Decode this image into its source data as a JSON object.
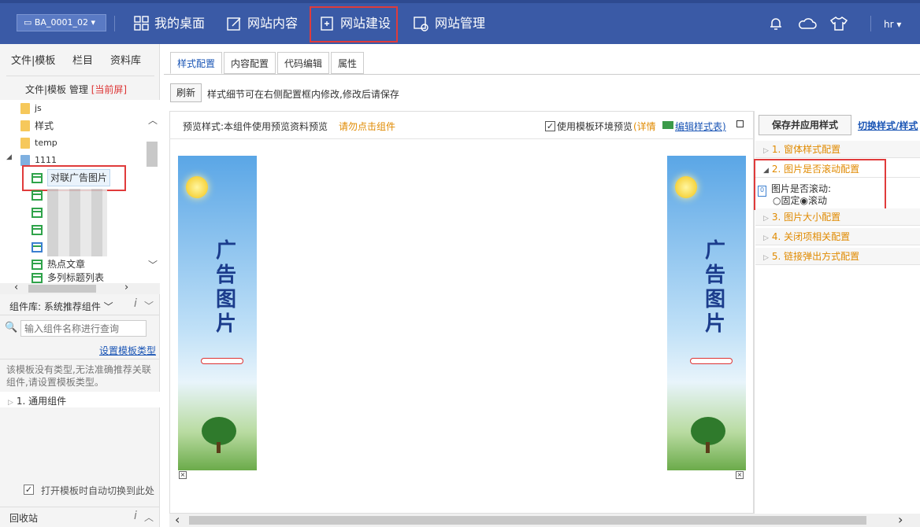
{
  "header": {
    "site": "BA_0001_02",
    "nav": [
      "我的桌面",
      "网站内容",
      "网站建设",
      "网站管理"
    ],
    "user": "hr"
  },
  "sidebar": {
    "tabs": [
      "文件|模板",
      "栏目",
      "资料库"
    ],
    "manage_label": "文件|模板 管理",
    "current_screen": "[当前屏]",
    "tree": [
      "js",
      "样式",
      "temp",
      "1111",
      "对联广告图片",
      "热点文章",
      "多列标题列表"
    ],
    "lib_label": "组件库: 系统推荐组件",
    "search_placeholder": "输入组件名称进行查询",
    "set_type_link": "设置模板类型",
    "notice": "该模板没有类型,无法准确推荐关联组件,请设置模板类型。",
    "group": "1. 通用组件",
    "auto_switch": "打开模板时自动切换到此处",
    "recycle": "回收站"
  },
  "main": {
    "tabs": [
      "样式配置",
      "内容配置",
      "代码编辑",
      "属性"
    ],
    "refresh": "刷新",
    "hint": "样式细节可在右侧配置框内修改,修改后请保存",
    "preview_text": "预览样式:本组件使用预览资料预览",
    "preview_warn": "请勿点击组件",
    "use_env": "使用模板环境预览",
    "detail": "(详情",
    "edit_style": "编辑样式表)",
    "ad_text": "广告图片"
  },
  "right": {
    "save": "保存并应用样式",
    "switch": "切换样式/样式",
    "sections": [
      "1. 窗体样式配置",
      "2. 图片是否滚动配置",
      "3. 图片大小配置",
      "4. 关闭项相关配置",
      "5. 链接弹出方式配置"
    ],
    "scroll_label": "图片是否滚动:",
    "opt_fixed": "固定",
    "opt_scroll": "滚动"
  }
}
